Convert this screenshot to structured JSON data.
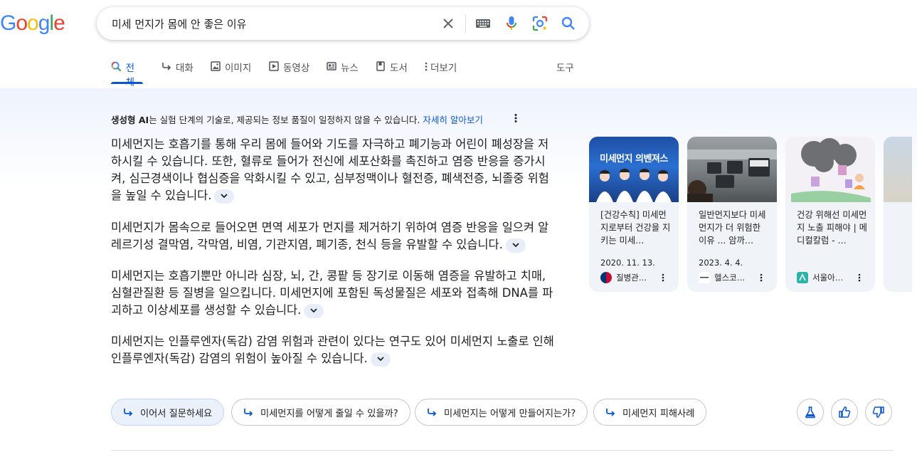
{
  "logo": {
    "letters": [
      "G",
      "o",
      "o",
      "g",
      "l",
      "e"
    ],
    "colors": [
      "#4285F4",
      "#EA4335",
      "#FBBC05",
      "#4285F4",
      "#34A853",
      "#EA4335"
    ]
  },
  "search": {
    "query": "미세 먼지가 몸에 안 좋은 이유"
  },
  "tabs": [
    {
      "label": "전체",
      "icon": "search-icon",
      "active": true
    },
    {
      "label": "대화",
      "icon": "reply-arrow-icon"
    },
    {
      "label": "이미지",
      "icon": "image-icon"
    },
    {
      "label": "동영상",
      "icon": "video-icon"
    },
    {
      "label": "뉴스",
      "icon": "news-icon"
    },
    {
      "label": "도서",
      "icon": "book-icon"
    },
    {
      "label": "더보기",
      "icon": "more-vert-icon"
    }
  ],
  "tools_label": "도구",
  "ai": {
    "disclaimer_bold": "생성형 AI",
    "disclaimer_text": "는 실험 단계의 기술로, 제공되는 정보 품질이 일정하지 않을 수 있습니다.",
    "learn_more": "자세히 알아보기",
    "paragraphs": [
      "미세먼지는 호흡기를 통해 우리 몸에 들어와 기도를 자극하고 폐기능과 어린이 폐성장을 저하시킬 수 있습니다. 또한, 혈류로 들어가 전신에 세포산화를 촉진하고 염증 반응을 증가시켜, 심근경색이나 협심증을 악화시킬 수 있고, 심부정맥이나 혈전증, 폐색전증, 뇌졸중 위험을 높일 수 있습니다.",
      "미세먼지가 몸속으로 들어오면 면역 세포가 먼지를 제거하기 위하여 염증 반응을 일으켜 알레르기성 결막염, 각막염, 비염, 기관지염, 폐기종, 천식 등을 유발할 수 있습니다.",
      "미세먼지는 호흡기뿐만 아니라 심장, 뇌, 간, 콩팥 등 장기로 이동해 염증을 유발하고 치매, 심혈관질환 등 질병을 일으킵니다. 미세먼지에 포함된 독성물질은 세포와 접촉해 DNA를 파괴하고 이상세포를 생성할 수 있습니다.",
      "미세먼지는 인플루엔자(독감) 감염 위험과 관련이 있다는 연구도 있어 미세먼지 노출로 인해 인플루엔자(독감) 감염의 위험이 높아질 수 있습니다."
    ]
  },
  "cards": [
    {
      "thumb_text": "미세먼지 의벤져스",
      "title": "[건강수칙] 미세먼지로부터 건강을 지키는 미세…",
      "date": "2020. 11. 13.",
      "source": "질병관…"
    },
    {
      "thumb_text": "",
      "title": "일반먼지보다 미세먼지가 더 위험한 이유 ... 암까…",
      "date": "2023. 4. 4.",
      "source": "헬스코…"
    },
    {
      "thumb_text": "",
      "title": "건강 위해선 미세먼지 노출 피해야 | 메디컬칼럼 - …",
      "date": "",
      "source": "서울아…"
    }
  ],
  "chips": [
    {
      "label": "이어서 질문하세요",
      "primary": true
    },
    {
      "label": "미세먼지를 어떻게 줄일 수 있을까?"
    },
    {
      "label": "미세먼지는 어떻게 만들어지는가?"
    },
    {
      "label": "미세먼지 피해사례"
    }
  ],
  "colors": {
    "accent": "#0b57d0",
    "text": "#1f1f1f",
    "muted": "#4d5156",
    "card_bg": "#f0f4f9"
  }
}
